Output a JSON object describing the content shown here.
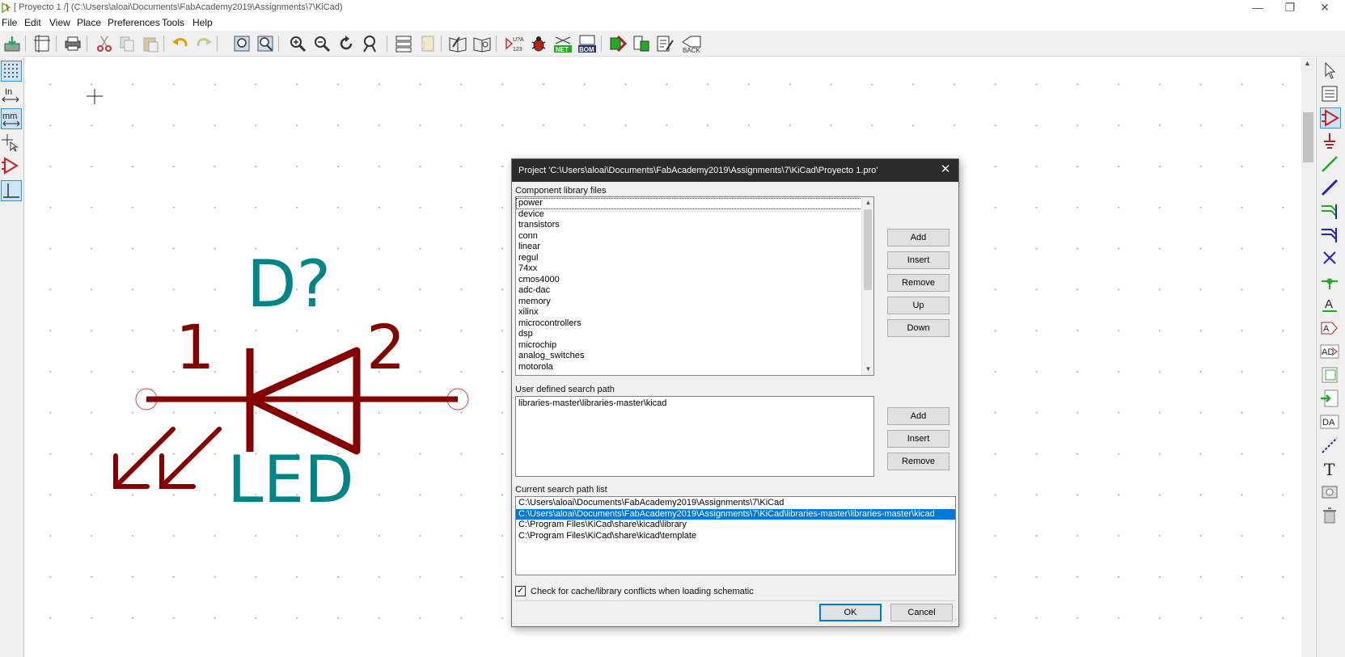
{
  "window": {
    "title": "[ Proyecto 1 /] (C:\\Users\\aloai\\Documents\\FabAcademy2019\\Assignments\\7\\KiCad)",
    "controls": {
      "minimize": "—",
      "maximize": "❐",
      "close": "✕"
    }
  },
  "menu": [
    "File",
    "Edit",
    "View",
    "Place",
    "Preferences",
    "Tools",
    "Help"
  ],
  "toolbar": {
    "icons": [
      "save-icon",
      "page-settings-icon",
      "print-icon",
      "cut-icon",
      "copy-icon",
      "paste-icon",
      "undo-icon",
      "redo-icon",
      "find-icon",
      "find-replace-icon",
      "zoom-in-icon",
      "zoom-out-icon",
      "redraw-icon",
      "zoom-fit-icon",
      "hierarchy-icon",
      "leave-sheet-icon",
      "library-editor-icon",
      "library-browser-icon",
      "annotate-icon",
      "erc-icon",
      "netlist-icon",
      "bom-icon",
      "assign-footprints-icon",
      "cvpcb-icon",
      "pcbnew-icon",
      "back-import-icon"
    ],
    "labels": {
      "annotate_u": "U?A",
      "annotate_n": "123",
      "netlist": "NET",
      "bom": "BOM",
      "back": "BACK"
    }
  },
  "left_toolbar": {
    "units_in": "In",
    "units_mm": "mm"
  },
  "schematic": {
    "led": {
      "reference": "D?",
      "value": "LED",
      "pin1": "1",
      "pin2": "2"
    }
  },
  "dialog": {
    "title": "Project 'C:\\Users\\aloai\\Documents\\FabAcademy2019\\Assignments\\7\\KiCad\\Proyecto 1.pro'",
    "close": "✕",
    "component_libs_label": "Component library files",
    "component_libs": [
      "power",
      "device",
      "transistors",
      "conn",
      "linear",
      "regul",
      "74xx",
      "cmos4000",
      "adc-dac",
      "memory",
      "xilinx",
      "microcontrollers",
      "dsp",
      "microchip",
      "analog_switches",
      "motorola"
    ],
    "lib_buttons": {
      "add": "Add",
      "insert": "Insert",
      "remove": "Remove",
      "up": "Up",
      "down": "Down"
    },
    "user_path_label": "User defined search path",
    "user_paths": [
      "libraries-master\\libraries-master\\kicad"
    ],
    "path_buttons": {
      "add": "Add",
      "insert": "Insert",
      "remove": "Remove"
    },
    "current_path_label": "Current search path list",
    "current_paths": [
      "C:\\Users\\aloai\\Documents\\FabAcademy2019\\Assignments\\7\\KiCad",
      "C:\\Users\\aloai\\Documents\\FabAcademy2019\\Assignments\\7\\KiCad\\libraries-master\\libraries-master\\kicad",
      "C:\\Program Files\\KiCad\\share\\kicad\\library",
      "C:\\Program Files\\KiCad\\share\\kicad\\template"
    ],
    "current_paths_selected": 1,
    "check_conflicts_label": "Check for cache/library conflicts when loading schematic",
    "check_conflicts_checked": true,
    "ok": "OK",
    "cancel": "Cancel"
  },
  "colors": {
    "schematic_body": "#840000",
    "schematic_text": "#008484",
    "selection": "#0078d7"
  }
}
